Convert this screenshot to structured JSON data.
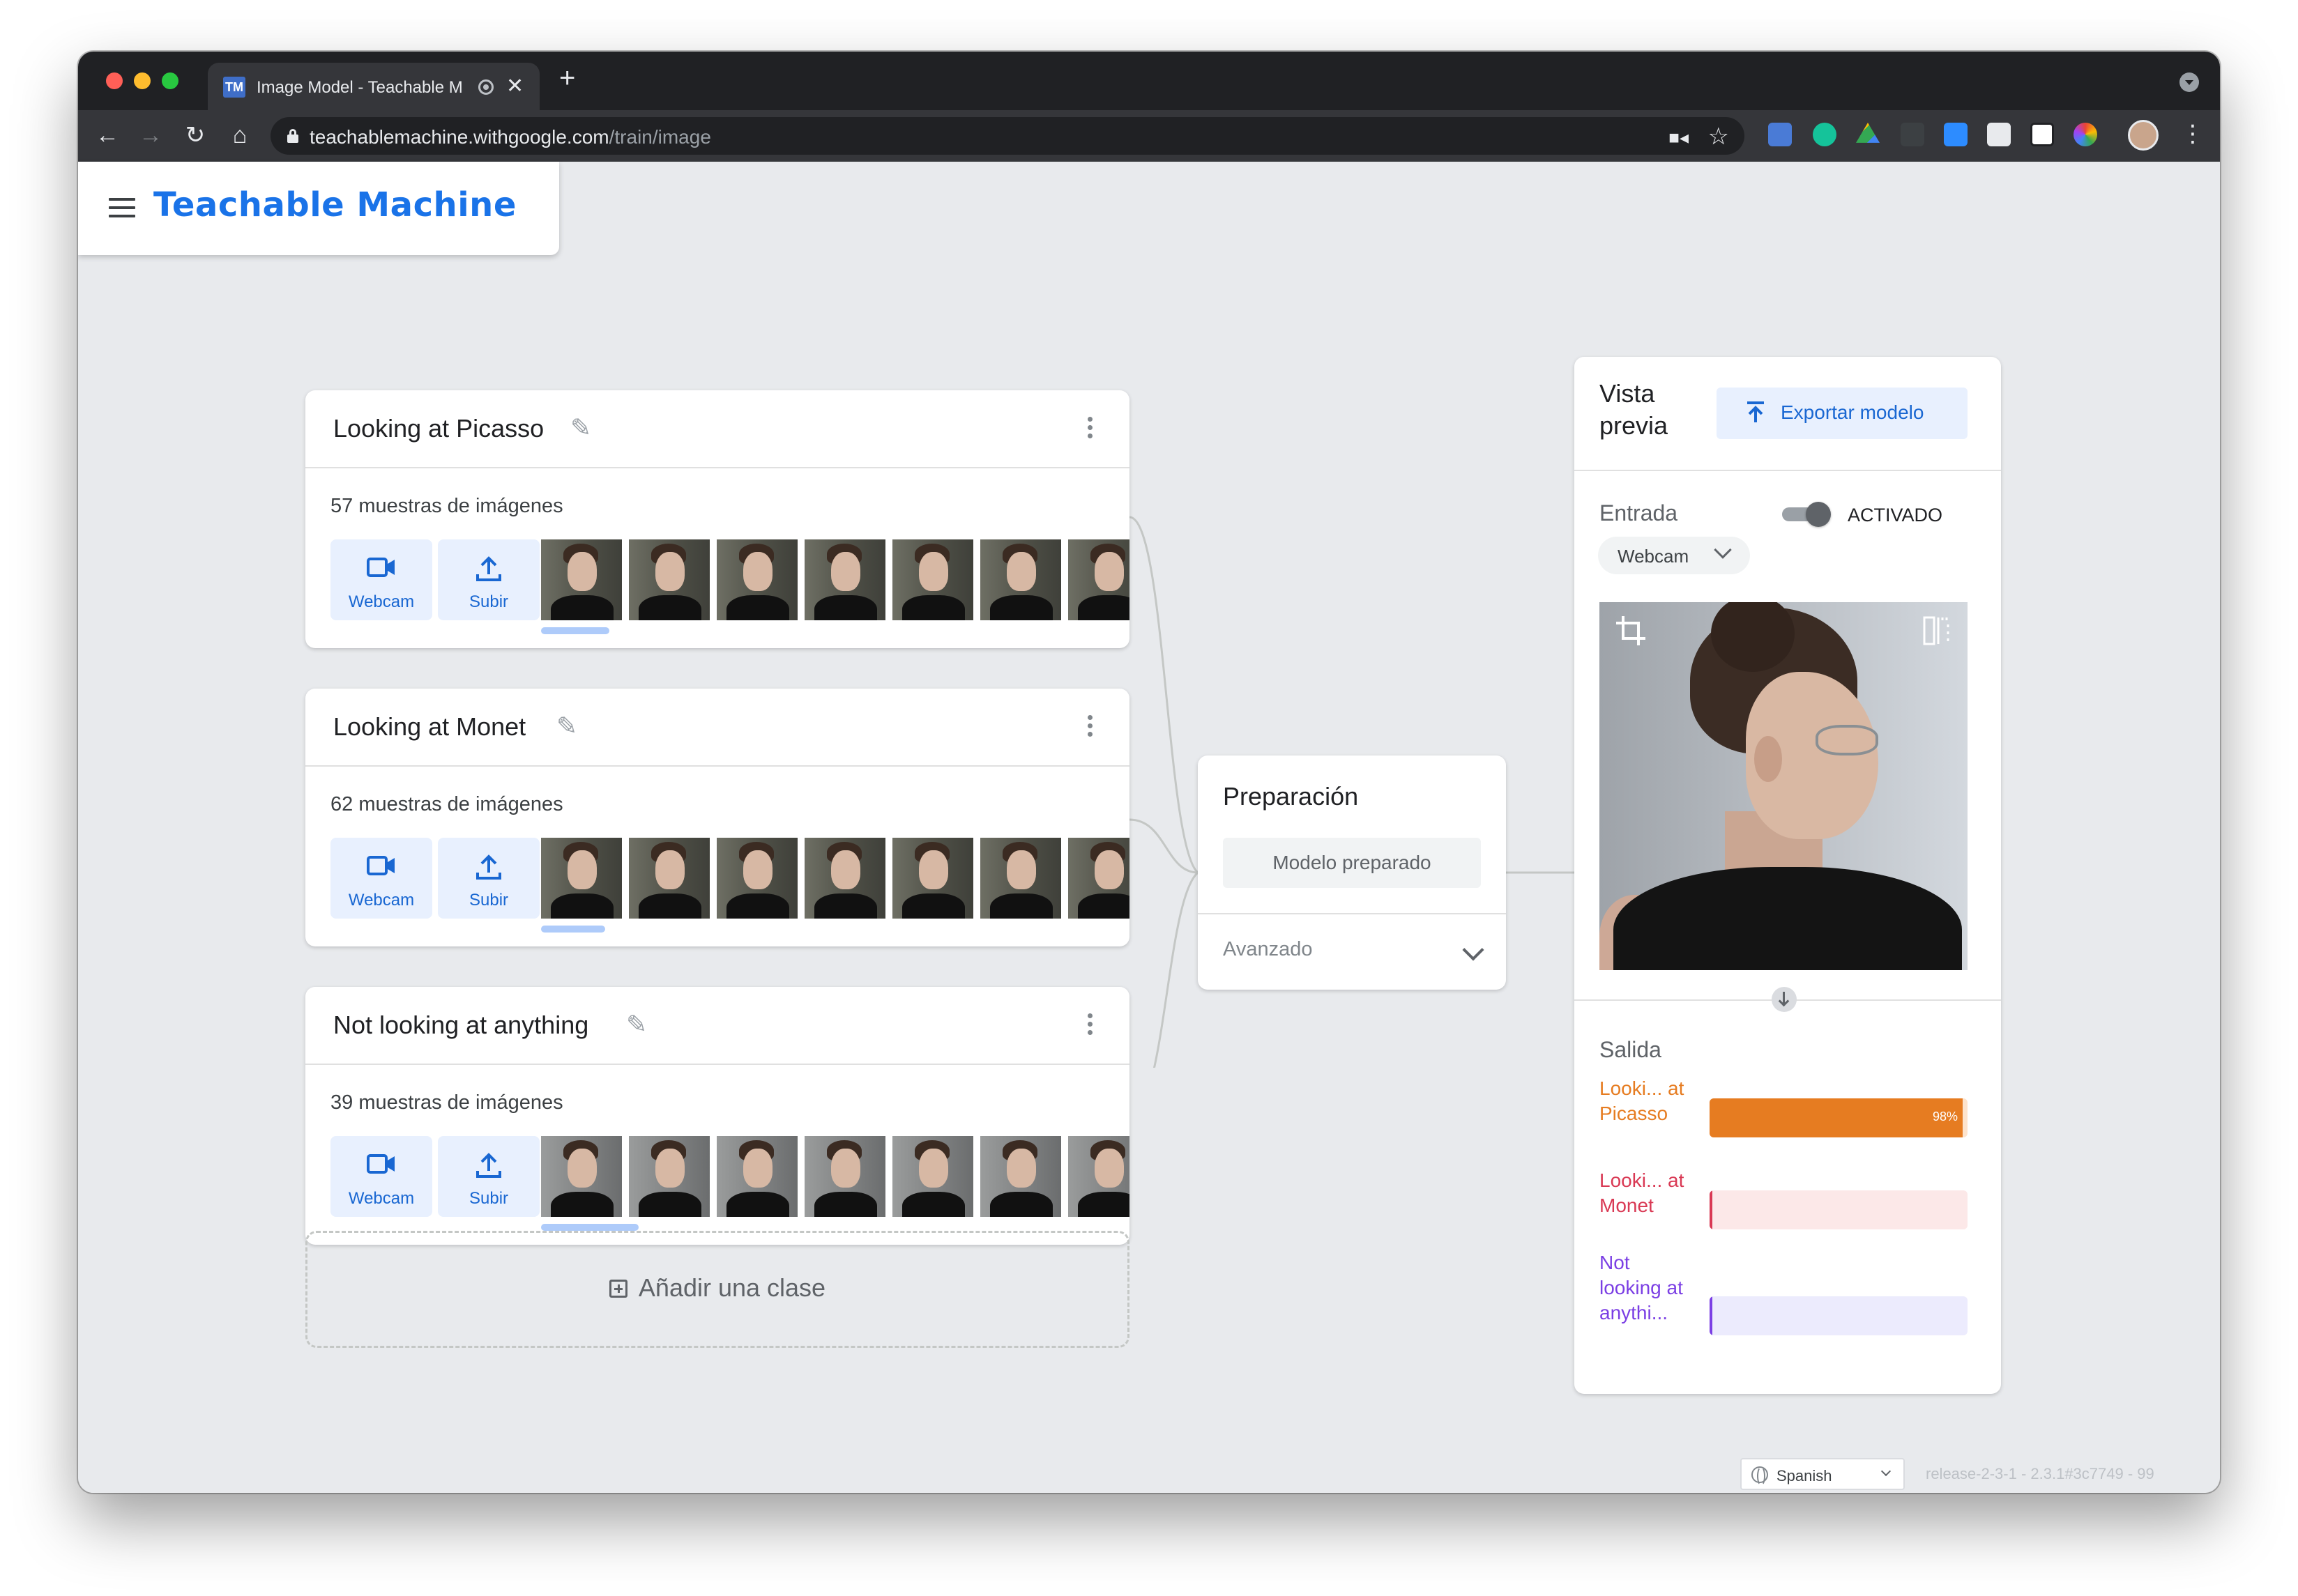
{
  "browser": {
    "tab_title": "Image Model - Teachable M",
    "favicon_text": "TM",
    "url_host": "teachablemachine.withgoogle.com",
    "url_path": "/train/image"
  },
  "app": {
    "title": "Teachable Machine"
  },
  "classes": [
    {
      "name": "Looking at Picasso",
      "samples": "57 muestras de imágenes",
      "webcam_label": "Webcam",
      "upload_label": "Subir"
    },
    {
      "name": "Looking at Monet",
      "samples": "62 muestras de imágenes",
      "webcam_label": "Webcam",
      "upload_label": "Subir"
    },
    {
      "name": "Not looking at anything",
      "samples": "39 muestras de imágenes",
      "webcam_label": "Webcam",
      "upload_label": "Subir"
    }
  ],
  "add_class_label": "Añadir una clase",
  "training": {
    "title": "Preparación",
    "button_label": "Modelo preparado",
    "advanced_label": "Avanzado"
  },
  "preview": {
    "title": "Vista previa",
    "export_label": "Exportar modelo",
    "input_label": "Entrada",
    "toggle_label": "ACTIVADO",
    "toggle_on": true,
    "source_label": "Webcam",
    "output_label": "Salida",
    "outputs": [
      {
        "label": "Looki... at Picasso",
        "percent_text": "98%",
        "confidence": 0.98,
        "color": "#e67c21",
        "bg": "#fde3cc"
      },
      {
        "label": "Looki... at Monet",
        "percent_text": "",
        "confidence": 0.01,
        "color": "#d93954",
        "bg": "#fce8e8"
      },
      {
        "label": "Not looking at anythi...",
        "percent_text": "",
        "confidence": 0.01,
        "color": "#7b3fe4",
        "bg": "#ecebfd"
      }
    ]
  },
  "footer": {
    "language": "Spanish",
    "version": "release-2-3-1 - 2.3.1#3c7749 - 99"
  },
  "colors": {
    "accent": "#1a73e8",
    "page_bg": "#e8eaed"
  }
}
